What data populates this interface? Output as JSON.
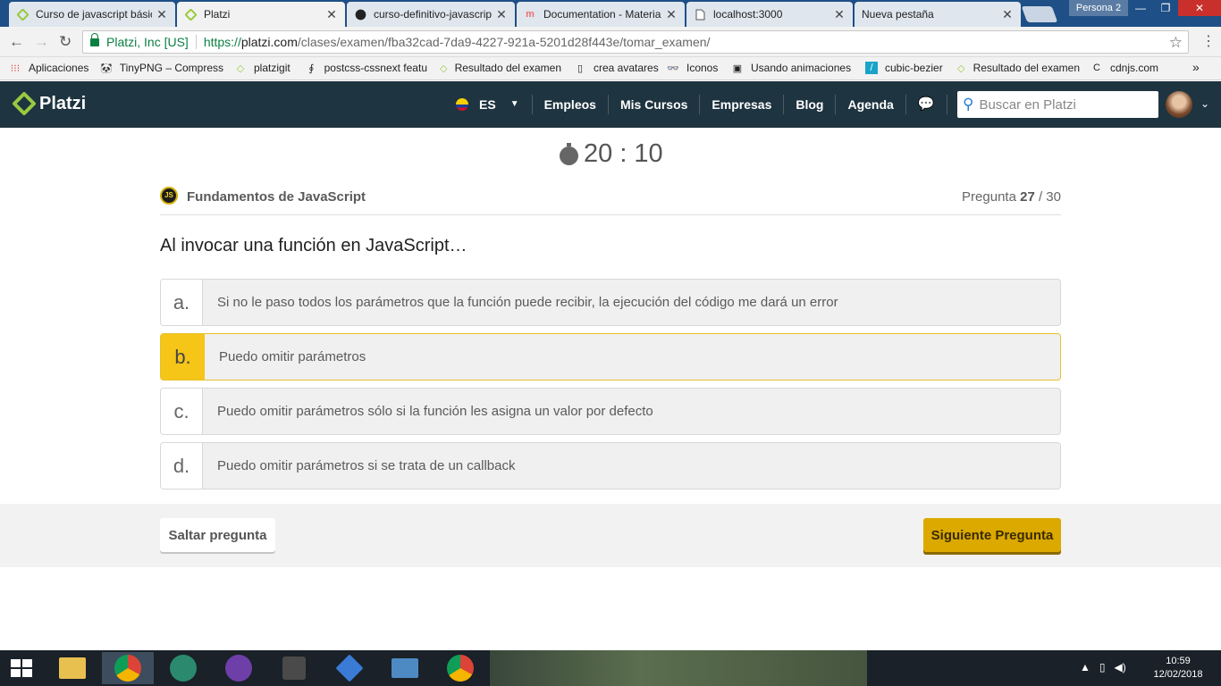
{
  "browser": {
    "tabs": [
      {
        "title": "Curso de javascript básico",
        "icon": "platzi-icon"
      },
      {
        "title": "Platzi",
        "icon": "platzi-icon"
      },
      {
        "title": "curso-definitivo-javascript",
        "icon": "github-icon"
      },
      {
        "title": "Documentation - Materialize",
        "icon": "materialize-icon"
      },
      {
        "title": "localhost:3000",
        "icon": "page-icon"
      },
      {
        "title": "Nueva pestaña",
        "icon": "blank-icon"
      }
    ],
    "profile": "Persona 2",
    "security_label": "Platzi, Inc [US]",
    "url": {
      "scheme": "https://",
      "host": "platzi.com",
      "path": "/clases/examen/fba32cad-7da9-4227-921a-5201d28f443e/tomar_examen/"
    },
    "bookmarks": [
      "Aplicaciones",
      "TinyPNG – Compress",
      "platzigit",
      "postcss-cssnext featu",
      "Resultado del examen",
      "crea avatares",
      "Iconos",
      "Usando animaciones",
      "cubic-bezier",
      "Resultado del examen",
      "cdnjs.com"
    ],
    "bookmarks_more": "»"
  },
  "site_nav": {
    "logo": "Platzi",
    "language": "ES",
    "links": [
      "Empleos",
      "Mis Cursos",
      "Empresas",
      "Blog",
      "Agenda"
    ],
    "search_placeholder": "Buscar en Platzi"
  },
  "exam": {
    "timer": "20 : 10",
    "course_badge": "JS",
    "course_name": "Fundamentos de JavaScript",
    "question_label": "Pregunta",
    "question_current": "27",
    "question_total": "/ 30",
    "question": "Al invocar una función en JavaScript…",
    "answers": [
      {
        "letter": "a.",
        "text": "Si no le paso todos los parámetros que la función puede recibir, la ejecución del código me dará un error",
        "selected": false
      },
      {
        "letter": "b.",
        "text": "Puedo omitir parámetros",
        "selected": true
      },
      {
        "letter": "c.",
        "text": "Puedo omitir parámetros sólo si la función les asigna un valor por defecto",
        "selected": false
      },
      {
        "letter": "d.",
        "text": "Puedo omitir parámetros si se trata de un callback",
        "selected": false
      }
    ],
    "skip_label": "Saltar pregunta",
    "next_label": "Siguiente Pregunta"
  },
  "taskbar": {
    "time": "10:59",
    "date": "12/02/2018"
  },
  "colors": {
    "nav_bg": "#1e3440",
    "platzi_green": "#98ca3f",
    "selected_answer": "#f5c518",
    "next_button": "#dba900"
  }
}
